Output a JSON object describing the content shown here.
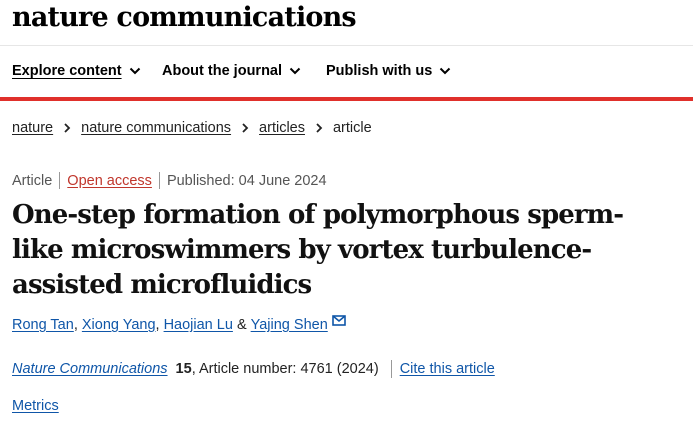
{
  "site": {
    "brand": "nature communications"
  },
  "nav": {
    "items": [
      {
        "label": "Explore content"
      },
      {
        "label": "About the journal"
      },
      {
        "label": "Publish with us"
      }
    ]
  },
  "breadcrumb": {
    "items": [
      "nature",
      "nature communications",
      "articles"
    ],
    "current": "article"
  },
  "article": {
    "type": "Article",
    "access": "Open access",
    "published": "Published: 04 June 2024",
    "title": "One-step formation of polymorphous sperm-like microswimmers by vortex turbulence-assisted microfluidics",
    "authors": [
      {
        "name": "Rong Tan"
      },
      {
        "name": "Xiong Yang"
      },
      {
        "name": "Haojian Lu"
      },
      {
        "name": "Yajing Shen"
      }
    ],
    "author_conjunction": "&",
    "journal": "Nature Communications",
    "volume": "15",
    "article_number_text": ", Article number: 4761 (2024)",
    "cite_label": "Cite this article",
    "metrics_label": "Metrics"
  },
  "colors": {
    "accent_red": "#e0302b",
    "link_blue": "#0f56a8",
    "open_access": "#c0362c"
  }
}
